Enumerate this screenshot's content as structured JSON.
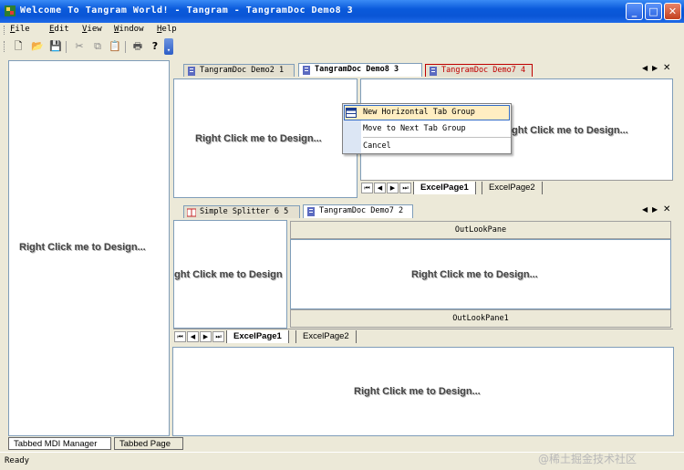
{
  "window": {
    "title": "Welcome To Tangram World! - Tangram - TangramDoc Demo8 3"
  },
  "menu": [
    {
      "label": "File",
      "mnemonic": "F",
      "rest": "ile"
    },
    {
      "label": "Edit",
      "mnemonic": "E",
      "rest": "dit"
    },
    {
      "label": "View",
      "mnemonic": "V",
      "rest": "iew"
    },
    {
      "label": "Window",
      "mnemonic": "W",
      "rest": "indow"
    },
    {
      "label": "Help",
      "mnemonic": "H",
      "rest": "elp"
    }
  ],
  "toolbar": {
    "icons": [
      "new-file-icon",
      "open-folder-icon",
      "save-icon",
      "cut-icon",
      "copy-icon",
      "paste-icon",
      "print-icon",
      "help-icon",
      "toolbar-overflow-icon"
    ]
  },
  "design_prompt": "Right Click me to Design...",
  "design_prompt_cut": "ght Click me to Design",
  "top_group": {
    "tabs": [
      "TangramDoc Demo2 1",
      "TangramDoc Demo8 3",
      "TangramDoc Demo7 4"
    ],
    "sheet_tabs": [
      "ExcelPage1",
      "ExcelPage2"
    ]
  },
  "mid_group": {
    "tabs": [
      "Simple Splitter 6 5",
      "TangramDoc Demo7 2"
    ],
    "outlook_top": "OutLookPane",
    "outlook_bottom": "OutLookPane1",
    "sheet_tabs": [
      "ExcelPage1",
      "ExcelPage2"
    ]
  },
  "context_menu": {
    "items": [
      {
        "label": "New Horizontal Tab Group",
        "mnemonic": "H"
      },
      {
        "label": "Move to Next Tab Group",
        "mnemonic": "x"
      },
      {
        "label": "Cancel",
        "mnemonic": "a"
      }
    ]
  },
  "bottom_tabs": [
    "Tabbed MDI Manager",
    "Tabbed Page"
  ],
  "status": {
    "text": "Ready"
  },
  "watermark": "@稀土掘金技术社区",
  "colors": {
    "title_blue": "#0A5ADB",
    "highlight": "#FFEEC2",
    "highlight_border": "#316AC5",
    "red_tab": "#C00000"
  }
}
